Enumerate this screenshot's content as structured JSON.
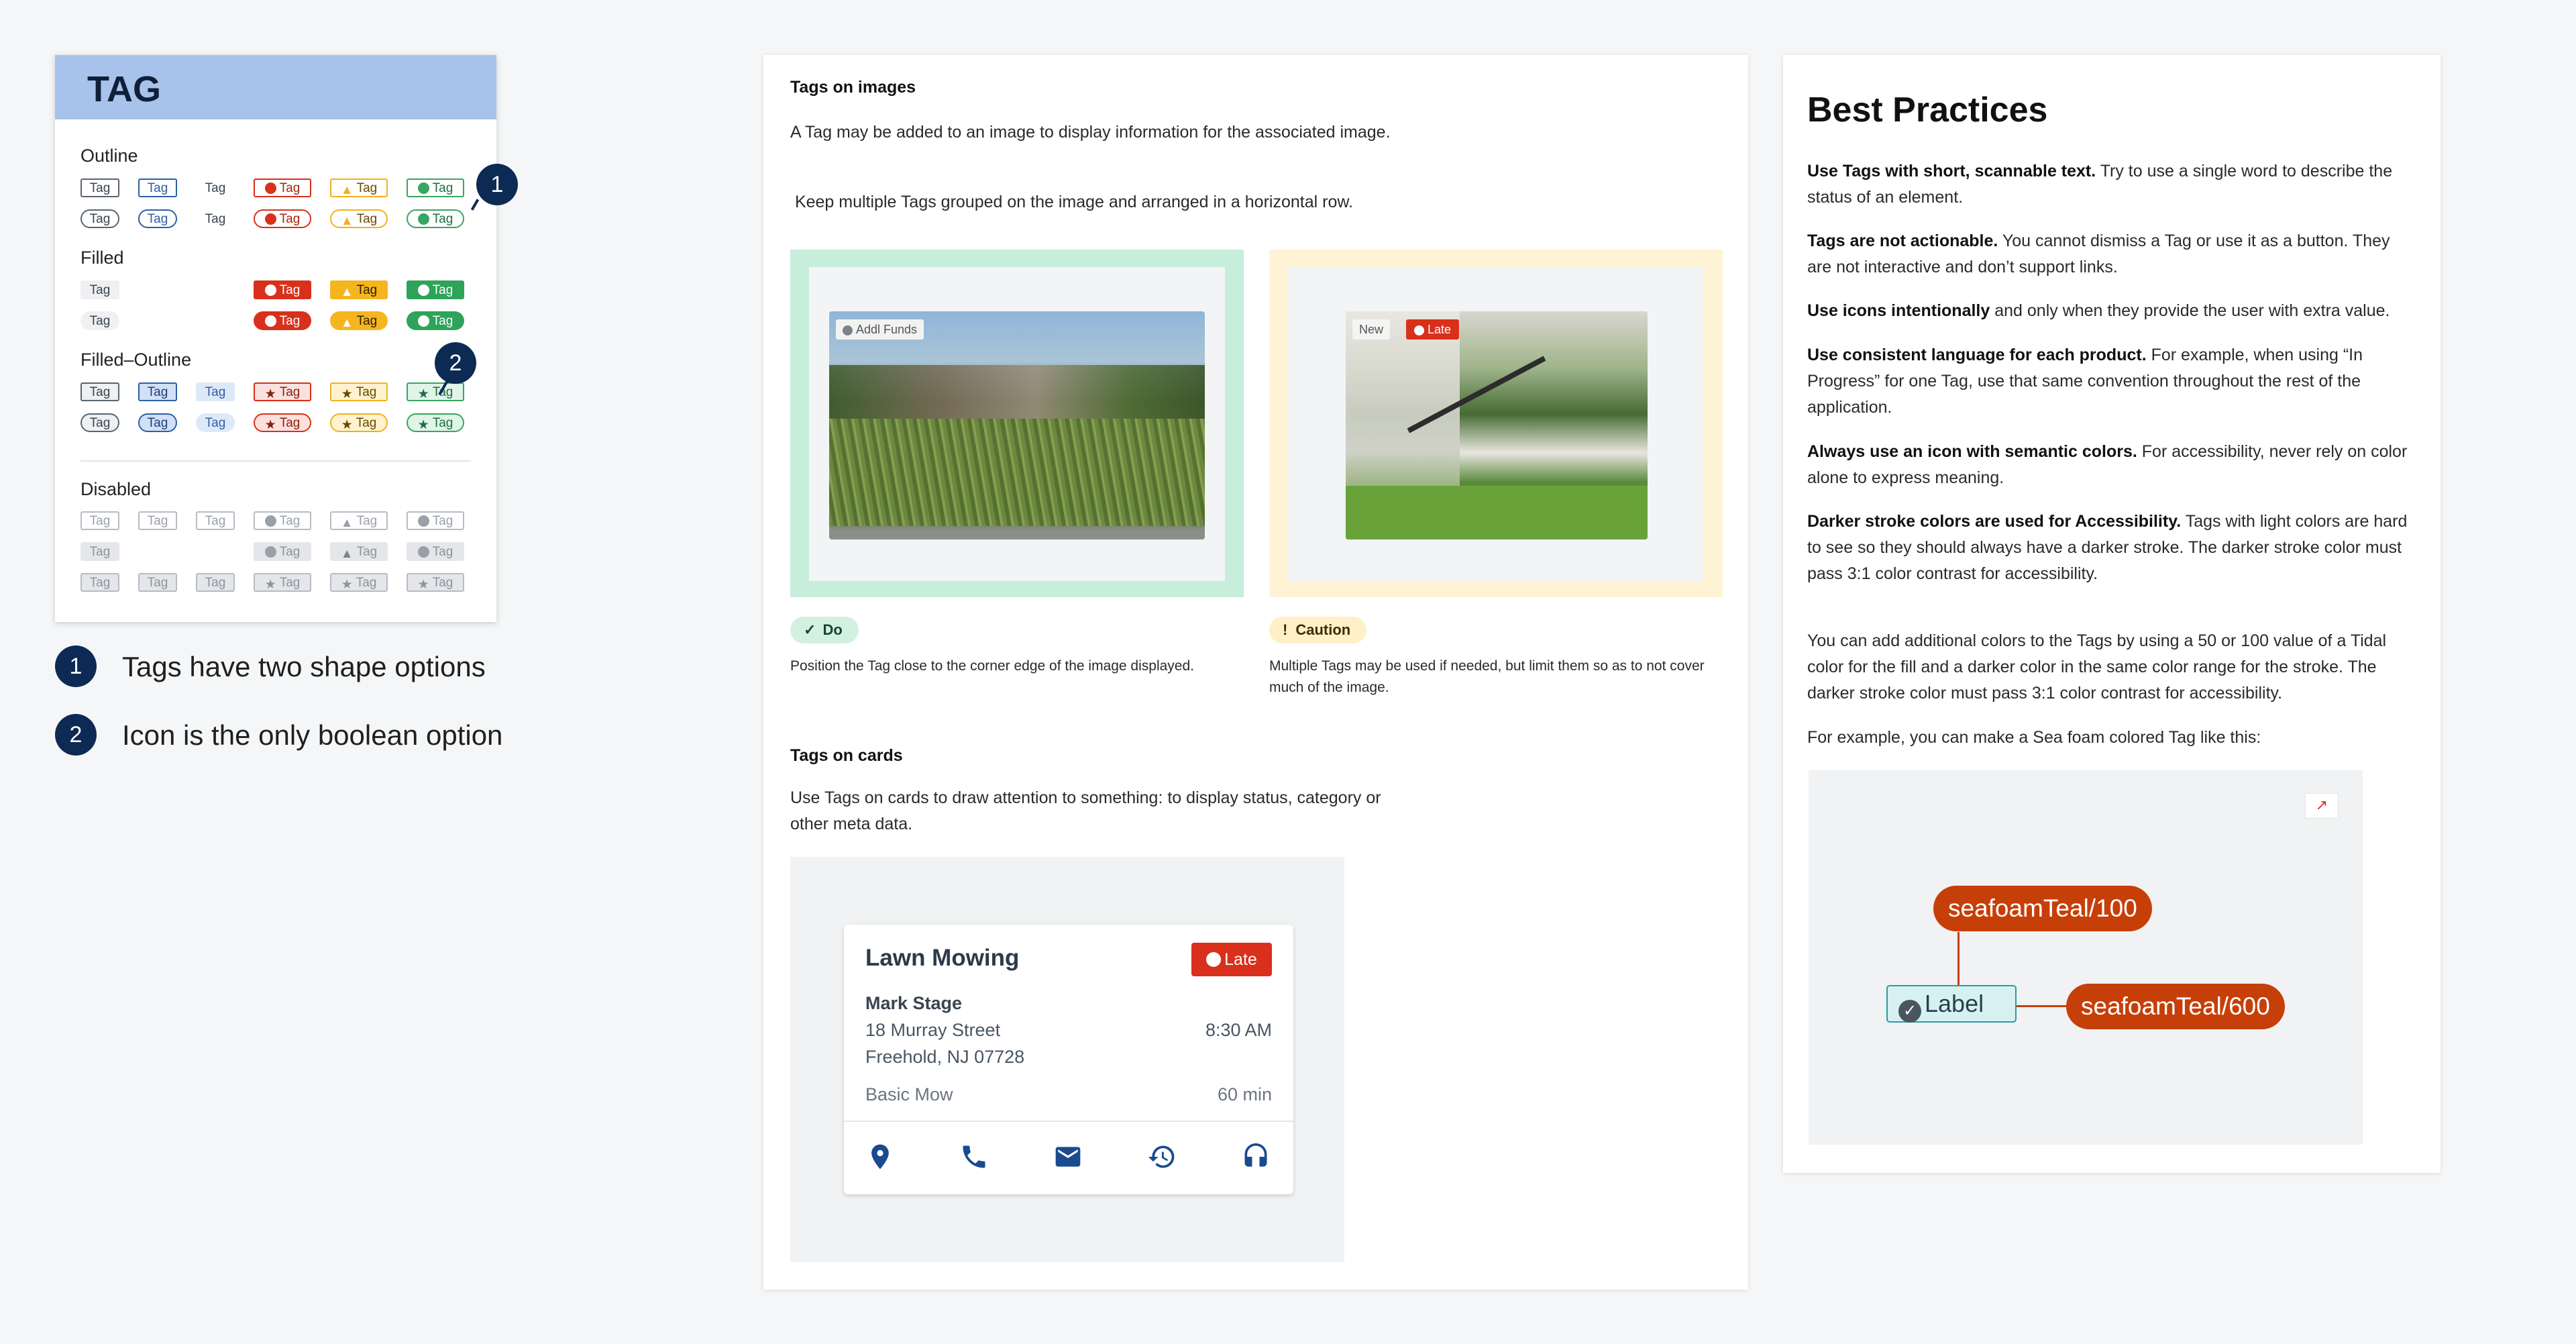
{
  "tag_card": {
    "title": "TAG",
    "sections": {
      "outline": "Outline",
      "filled": "Filled",
      "filled_outline": "Filled–Outline",
      "disabled": "Disabled"
    },
    "tag_text": "Tag",
    "callouts": [
      "1",
      "2"
    ]
  },
  "legend": [
    {
      "num": "1",
      "text": "Tags have two shape options"
    },
    {
      "num": "2",
      "text": "Icon is the only boolean option"
    }
  ],
  "images_section": {
    "heading": "Tags on images",
    "para1": "A Tag may be added to an image to display information for the associated image.",
    "para2": " Keep multiple Tags grouped on the image and arranged in a horizontal row.",
    "do_tag": "Addl Funds",
    "caution_tags": [
      "New",
      "Late"
    ],
    "do_label": "Do",
    "caution_label": "Caution",
    "do_caption": "Position the Tag close to the corner edge of the image displayed.",
    "caution_caption": "Multiple Tags may be used if needed, but limit them so as to not cover much of the image."
  },
  "cards_section": {
    "heading": "Tags on cards",
    "para": "Use Tags on cards to draw attention to something: to display status, category or other meta data.",
    "card": {
      "title": "Lawn Mowing",
      "tag": "Late",
      "name": "Mark Stage",
      "address1": "18 Murray Street",
      "address2": "Freehold, NJ 07728",
      "time": "8:30 AM",
      "service": "Basic Mow",
      "duration": "60 min",
      "actions": [
        "location-icon",
        "phone-icon",
        "email-icon",
        "history-icon",
        "headset-icon"
      ]
    }
  },
  "best_practices": {
    "title": "Best Practices",
    "items": [
      {
        "bold": "Use Tags with short, scannable text.",
        "text": " Try to use a single word to describe the status of an element."
      },
      {
        "bold": "Tags are not actionable.",
        "text": " You cannot dismiss a Tag or use it as a button. They are not interactive and don’t support links."
      },
      {
        "bold": "Use icons intentionally",
        "text": " and only when they provide the user with extra value."
      },
      {
        "bold": "Use consistent language for each product.",
        "text": " For example, when using “In Progress” for one Tag, use that same convention throughout the rest of the application."
      },
      {
        "bold": "Always use an icon with semantic colors.",
        "text": " For accessibility, never rely on color alone to express meaning."
      },
      {
        "bold": "Darker stroke colors are used for Accessibility.",
        "text": " Tags with light colors are hard to see so they should always have a darker stroke. The darker stroke color must pass 3:1 color contrast for accessibility."
      }
    ],
    "extra1": "You can add additional colors to the Tags by using a 50 or 100 value of a Tidal color for the fill and a darker color in the same color range for the stroke. The darker stroke color must pass 3:1 color contrast for accessibility.",
    "extra2": "For example, you can make a Sea foam colored Tag like this:",
    "example": {
      "fill_label": "seafoamTeal/100",
      "stroke_label": "seafoamTeal/600",
      "tag_label": "Label"
    }
  },
  "colors": {
    "header_blue": "#a7c3eb",
    "navy": "#0d2a55",
    "red": "#d9301b",
    "yellow": "#f5b51e",
    "green": "#2ea35a",
    "seafoam_annot": "#c73f08"
  }
}
